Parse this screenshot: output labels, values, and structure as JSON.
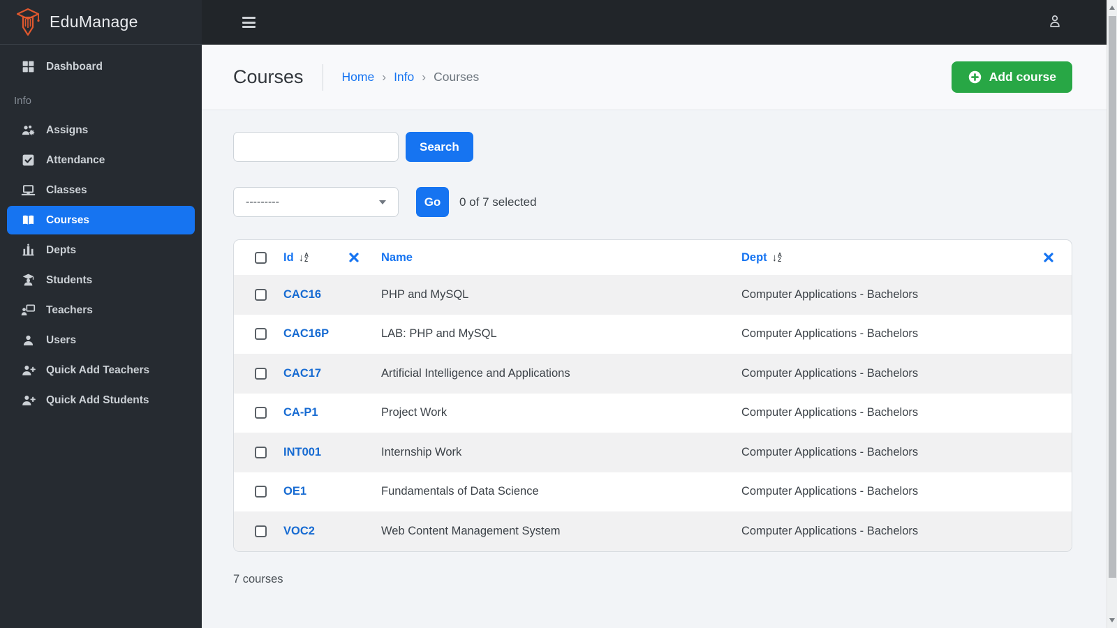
{
  "app": {
    "name": "EduManage"
  },
  "colors": {
    "accent_blue": "#1674f1",
    "success_green": "#28a745",
    "sidebar_bg": "#262b31",
    "topbar_bg": "#212529",
    "logo_orange": "#e0582e"
  },
  "sidebar": {
    "logo_text": "EduManage",
    "dashboard_label": "Dashboard",
    "section_label": "Info",
    "items": [
      {
        "label": "Assigns",
        "icon": "users-gear-icon",
        "active": false
      },
      {
        "label": "Attendance",
        "icon": "checkbox-check-icon",
        "active": false
      },
      {
        "label": "Classes",
        "icon": "laptop-icon",
        "active": false
      },
      {
        "label": "Courses",
        "icon": "open-book-icon",
        "active": true
      },
      {
        "label": "Depts",
        "icon": "building-icon",
        "active": false
      },
      {
        "label": "Students",
        "icon": "graduate-icon",
        "active": false
      },
      {
        "label": "Teachers",
        "icon": "presenter-icon",
        "active": false
      },
      {
        "label": "Users",
        "icon": "person-icon",
        "active": false
      },
      {
        "label": "Quick Add Teachers",
        "icon": "person-add-icon",
        "active": false
      },
      {
        "label": "Quick Add Students",
        "icon": "person-add-icon",
        "active": false
      }
    ]
  },
  "header": {
    "title": "Courses",
    "breadcrumb": {
      "home": "Home",
      "section": "Info",
      "current": "Courses",
      "separator": "›"
    },
    "add_course_label": "Add course"
  },
  "toolbar": {
    "search_value": "",
    "search_button_label": "Search",
    "action_select_value": "---------",
    "go_button_label": "Go",
    "selection_status": "0 of 7 selected"
  },
  "table": {
    "headers": {
      "id": "Id",
      "name": "Name",
      "dept": "Dept"
    },
    "rows": [
      {
        "id": "CAC16",
        "name": "PHP and MySQL",
        "dept": "Computer Applications - Bachelors"
      },
      {
        "id": "CAC16P",
        "name": "LAB: PHP and MySQL",
        "dept": "Computer Applications - Bachelors"
      },
      {
        "id": "CAC17",
        "name": "Artificial Intelligence and Applications",
        "dept": "Computer Applications - Bachelors"
      },
      {
        "id": "CA-P1",
        "name": "Project Work",
        "dept": "Computer Applications - Bachelors"
      },
      {
        "id": "INT001",
        "name": "Internship Work",
        "dept": "Computer Applications - Bachelors"
      },
      {
        "id": "OE1",
        "name": "Fundamentals of Data Science",
        "dept": "Computer Applications - Bachelors"
      },
      {
        "id": "VOC2",
        "name": "Web Content Management System",
        "dept": "Computer Applications - Bachelors"
      }
    ],
    "summary": "7 courses"
  }
}
